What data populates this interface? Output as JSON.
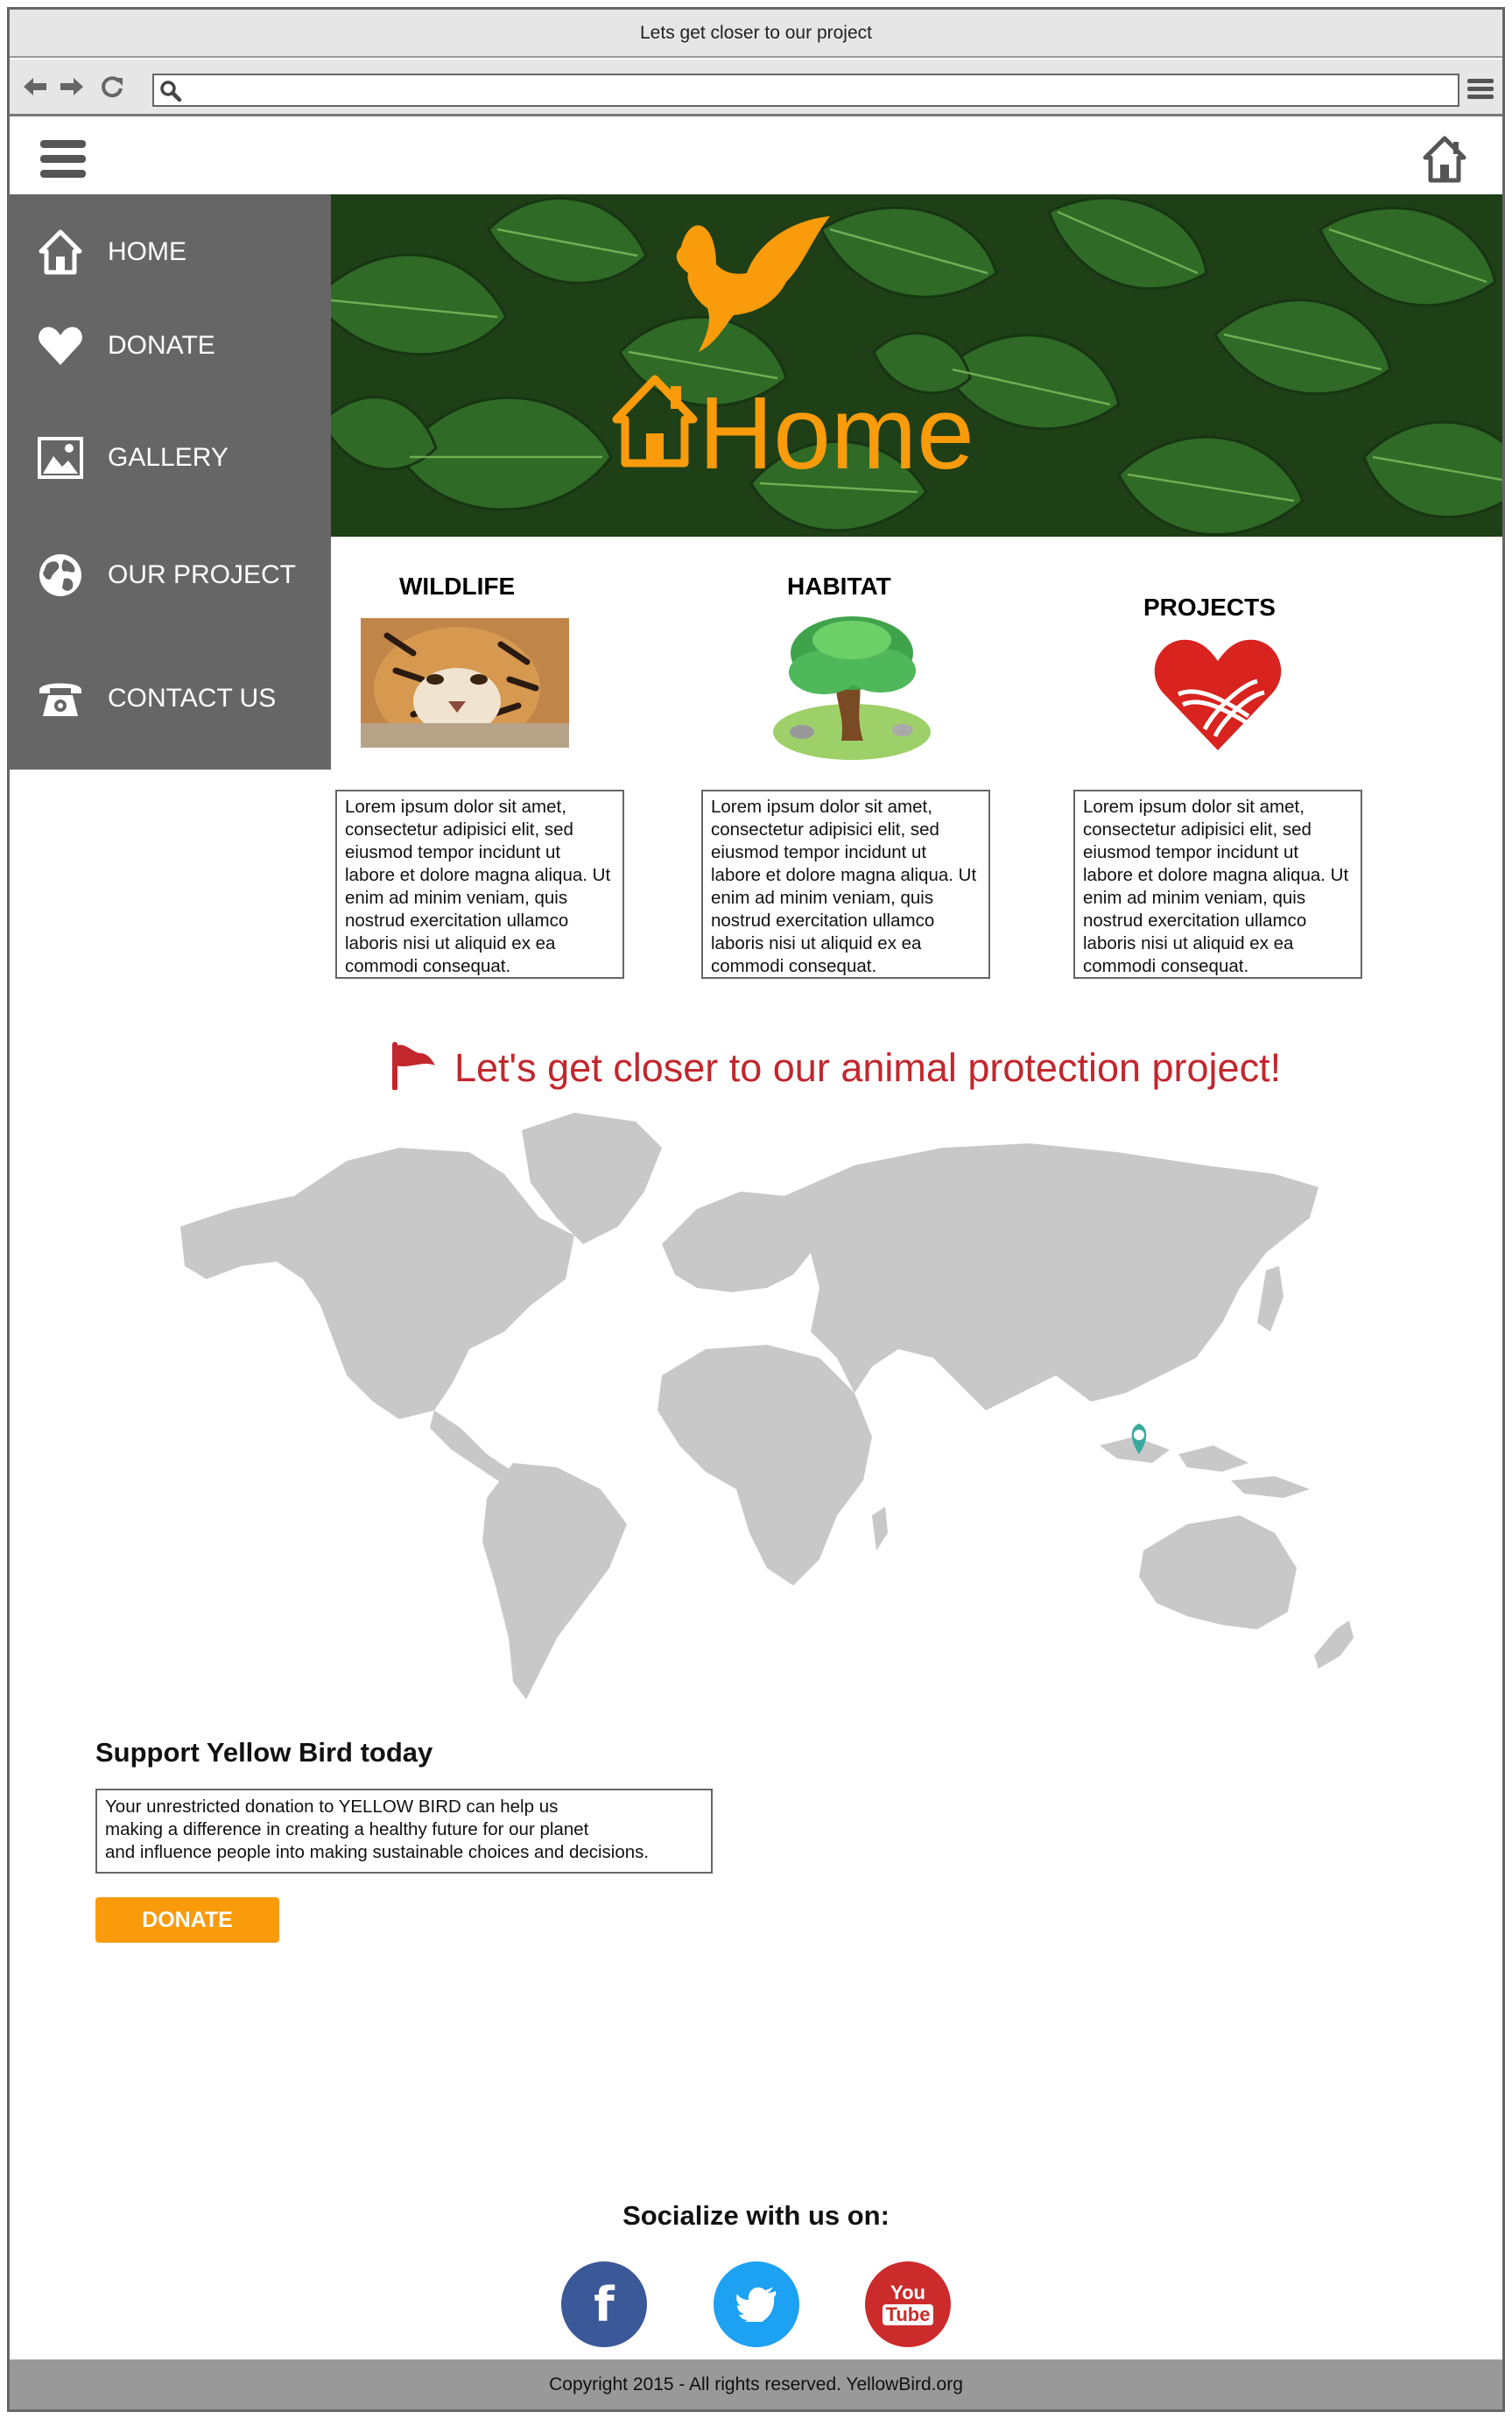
{
  "window": {
    "title": "Lets get closer to our project"
  },
  "toolbar": {
    "back_icon": "back-arrow-icon",
    "forward_icon": "forward-arrow-icon",
    "reload_icon": "reload-icon",
    "search_icon": "search-icon",
    "menu_icon": "menu-icon",
    "url_value": ""
  },
  "sidebar": {
    "items": [
      {
        "label": "HOME",
        "icon": "home-icon"
      },
      {
        "label": "DONATE",
        "icon": "heart-icon"
      },
      {
        "label": "GALLERY",
        "icon": "image-icon"
      },
      {
        "label": "OUR PROJECT",
        "icon": "globe-icon"
      },
      {
        "label": "CONTACT US",
        "icon": "telephone-icon"
      }
    ]
  },
  "hero": {
    "title": "Home"
  },
  "columns": [
    {
      "title": "WILDLIFE",
      "text": "Lorem ipsum dolor sit amet, consectetur adipisici elit, sed eiusmod tempor incidunt ut labore et dolore magna aliqua. Ut enim ad minim veniam, quis nostrud exercitation ullamco laboris nisi ut aliquid ex ea commodi consequat."
    },
    {
      "title": "HABITAT",
      "text": "Lorem ipsum dolor sit amet, consectetur adipisici elit, sed eiusmod tempor incidunt ut labore et dolore magna aliqua. Ut enim ad minim veniam, quis nostrud exercitation ullamco laboris nisi ut aliquid ex ea commodi consequat."
    },
    {
      "title": "PROJECTS",
      "text": "Lorem ipsum dolor sit amet, consectetur adipisici elit, sed eiusmod tempor incidunt ut labore et dolore magna aliqua. Ut enim ad minim veniam, quis nostrud exercitation ullamco laboris nisi ut aliquid ex ea commodi consequat."
    }
  ],
  "campaign": {
    "headline": "Let's get closer to our animal protection project!"
  },
  "support": {
    "title": "Support Yellow Bird today",
    "text": "Your unrestricted donation to YELLOW BIRD can help us\nmaking a difference in creating a healthy future for our planet\nand influence people into making sustainable choices and decisions.",
    "donate_label": "DONATE"
  },
  "social": {
    "title": "Socialize with us on:",
    "links": [
      {
        "name": "facebook",
        "glyph": "f",
        "color": "#3b5998"
      },
      {
        "name": "twitter",
        "color": "#1da1f2"
      },
      {
        "name": "youtube",
        "glyph_top": "You",
        "glyph_bottom": "Tube",
        "color": "#cc2b2b"
      }
    ]
  },
  "footer": {
    "copyright": "Copyright 2015  - All rights reserved. YellowBird.org"
  },
  "colors": {
    "accent": "#f99b0b",
    "sidebar": "#666666",
    "headline": "#c1272d",
    "map": "#c8c8c8",
    "pin": "#3aaa9e"
  }
}
